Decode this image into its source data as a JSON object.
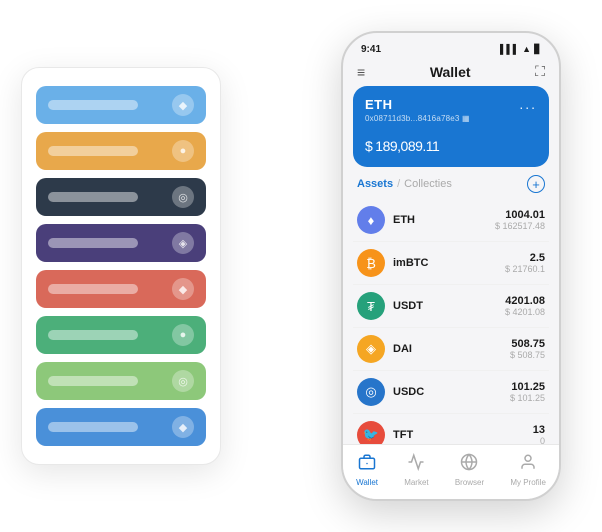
{
  "scene": {
    "bg": "#ffffff"
  },
  "leftPanel": {
    "cards": [
      {
        "color": "card-blue",
        "label": "",
        "icon": "◆"
      },
      {
        "color": "card-orange",
        "label": "",
        "icon": "●"
      },
      {
        "color": "card-dark",
        "label": "",
        "icon": "◎"
      },
      {
        "color": "card-purple",
        "label": "",
        "icon": "◈"
      },
      {
        "color": "card-red",
        "label": "",
        "icon": "◆"
      },
      {
        "color": "card-green",
        "label": "",
        "icon": "●"
      },
      {
        "color": "card-light-green",
        "label": "",
        "icon": "◎"
      },
      {
        "color": "card-blue2",
        "label": "",
        "icon": "◆"
      }
    ]
  },
  "phone": {
    "statusBar": {
      "time": "9:41",
      "signal": "▌▌▌",
      "wifi": "▲",
      "battery": "▊"
    },
    "header": {
      "menuIcon": "≡",
      "title": "Wallet",
      "scanIcon": "⛶"
    },
    "ethCard": {
      "name": "ETH",
      "address": "0x08711d3b...8416a78e3  ▦",
      "dots": "...",
      "currencySymbol": "$",
      "balance": "189,089.11"
    },
    "assetsTabs": {
      "active": "Assets",
      "divider": "/",
      "inactive": "Collecties"
    },
    "addButtonLabel": "+",
    "assets": [
      {
        "name": "ETH",
        "amount": "1004.01",
        "usd": "$ 162517.48",
        "iconColor": "#627EEA",
        "iconText": "♦"
      },
      {
        "name": "imBTC",
        "amount": "2.5",
        "usd": "$ 21760.1",
        "iconColor": "#f7931a",
        "iconText": "₿"
      },
      {
        "name": "USDT",
        "amount": "4201.08",
        "usd": "$ 4201.08",
        "iconColor": "#26a17b",
        "iconText": "₮"
      },
      {
        "name": "DAI",
        "amount": "508.75",
        "usd": "$ 508.75",
        "iconColor": "#F5A623",
        "iconText": "◈"
      },
      {
        "name": "USDC",
        "amount": "101.25",
        "usd": "$ 101.25",
        "iconColor": "#2775CA",
        "iconText": "◎"
      },
      {
        "name": "TFT",
        "amount": "13",
        "usd": "0",
        "iconColor": "#e74c3c",
        "iconText": "🐦"
      }
    ],
    "bottomNav": [
      {
        "id": "wallet",
        "label": "Wallet",
        "icon": "◎",
        "active": true
      },
      {
        "id": "market",
        "label": "Market",
        "icon": "▦",
        "active": false
      },
      {
        "id": "browser",
        "label": "Browser",
        "icon": "⊕",
        "active": false
      },
      {
        "id": "profile",
        "label": "My Profile",
        "icon": "◉",
        "active": false
      }
    ]
  }
}
